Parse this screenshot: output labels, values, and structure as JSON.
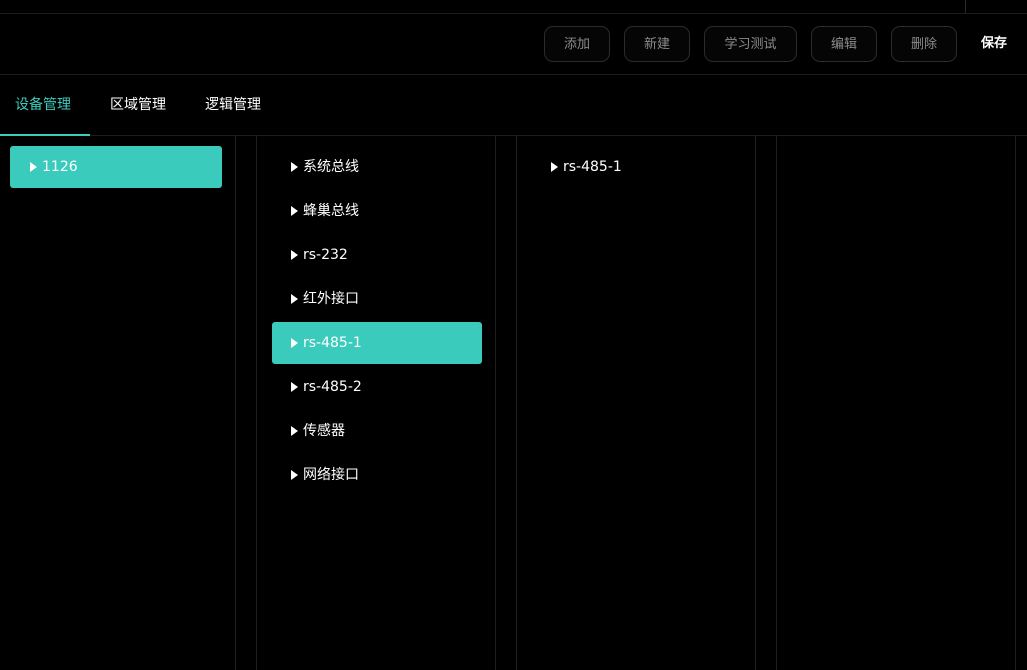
{
  "toolbar": {
    "add_label": "添加",
    "new_label": "新建",
    "learn_test_label": "学习测试",
    "edit_label": "编辑",
    "delete_label": "删除",
    "save_label": "保存"
  },
  "tabs": [
    {
      "label": "设备管理",
      "active": true
    },
    {
      "label": "区域管理",
      "active": false
    },
    {
      "label": "逻辑管理",
      "active": false
    }
  ],
  "column1": {
    "items": [
      {
        "label": "1126",
        "selected": true
      }
    ]
  },
  "column2": {
    "items": [
      {
        "label": "系统总线",
        "selected": false
      },
      {
        "label": "蜂巢总线",
        "selected": false
      },
      {
        "label": "rs-232",
        "selected": false
      },
      {
        "label": "红外接口",
        "selected": false
      },
      {
        "label": "rs-485-1",
        "selected": true
      },
      {
        "label": "rs-485-2",
        "selected": false
      },
      {
        "label": "传感器",
        "selected": false
      },
      {
        "label": "网络接口",
        "selected": false
      }
    ]
  },
  "column3": {
    "items": [
      {
        "label": "rs-485-1",
        "selected": false
      }
    ]
  },
  "colors": {
    "accent": "#3bcbbd",
    "background": "#000000",
    "button_text": "#8c8c8c"
  }
}
